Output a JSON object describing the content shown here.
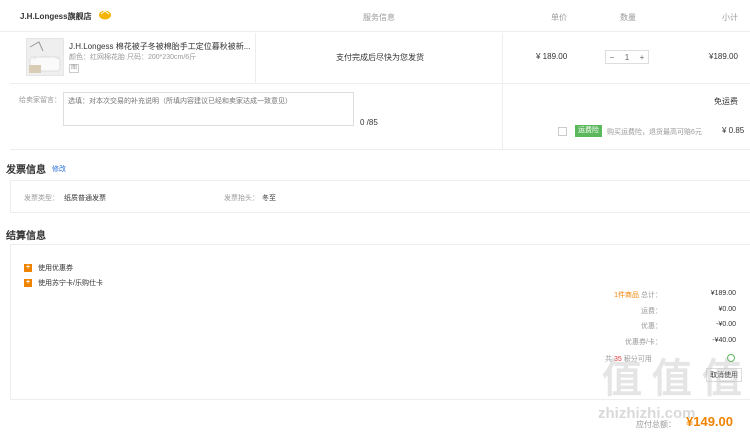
{
  "header": {
    "store_name": "J.H.Longess旗舰店",
    "col_service": "服务信息",
    "col_price": "单价",
    "col_qty": "数量",
    "col_subtotal": "小计"
  },
  "product": {
    "title": "J.H.Longess 棉花被子冬被棉胎手工定位暮秋被新...",
    "spec": "颜色：红网棉花胎  尺码：200*230cm/6斤",
    "tag": "图",
    "service": "支付完成后尽快为您发货",
    "price": "¥ 189.00",
    "qty": "1",
    "minus": "−",
    "plus": "+",
    "subtotal": "¥189.00"
  },
  "message": {
    "label": "给卖家留言：",
    "placeholder": "选填：对本次交易的补充说明（所填内容建议已经和卖家达成一致意见）",
    "count": "0 /85",
    "free_ship": "免运费",
    "ship_badge": "运费险",
    "ship_desc": "购买运费险，退货最高可赔6元",
    "ship_amount": "¥ 0.85"
  },
  "invoice": {
    "title": "发票信息",
    "edit": "修改",
    "type_label": "发票类型：",
    "type_value": "纸质普通发票",
    "head_label": "发票抬头：",
    "head_value": "冬至"
  },
  "settlement": {
    "title": "结算信息",
    "options": [
      "使用优惠券",
      "使用苏宁卡/乐购仕卡"
    ],
    "summary_count": "1件商品",
    "summary_total_label": "总计：",
    "summary_total": "¥189.00",
    "shipping_label": "运费：",
    "shipping_value": "¥0.00",
    "discount_label": "优惠：",
    "discount_value": "-¥0.00",
    "coupon_label": "优惠券/卡：",
    "coupon_value": "-¥40.00",
    "coupon_line_prefix": "共",
    "coupon_line_highlight": "35",
    "coupon_line_suffix": "积分可用",
    "coupon_action": "取消使用"
  },
  "total": {
    "label": "应付总额：",
    "value": "¥149.00"
  },
  "watermark": {
    "text": "值 值 值",
    "url": "zhizhizhi.com"
  },
  "colors": {
    "accent": "#f08300",
    "green": "#5cb85c",
    "link": "#2a6fdb"
  }
}
